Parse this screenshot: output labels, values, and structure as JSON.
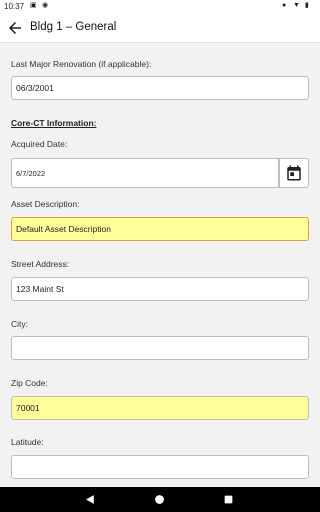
{
  "status_bar": {
    "time": "10:37",
    "icons": [
      "image-icon",
      "at-icon",
      "location-icon",
      "wifi-icon",
      "battery-icon"
    ]
  },
  "app_bar": {
    "title": "Bldg 1 – General",
    "back_icon": "arrow-back-icon"
  },
  "form": {
    "last_major_renovation": {
      "label": "Last Major Renovation (if applicable):",
      "value": "06/3/2001"
    },
    "section_title": "Core-CT Information:",
    "acquired_date": {
      "label": "Acquired Date:",
      "value": "6/7/2022",
      "button_icon": "calendar-icon"
    },
    "asset_description": {
      "label": "Asset Description:",
      "value": "Default Asset Description"
    },
    "street_address": {
      "label": "Street Address:",
      "value": "123 Maint St"
    },
    "city": {
      "label": "City:",
      "value": ""
    },
    "zip_code": {
      "label": "Zip Code:",
      "value": "70001"
    },
    "latitude": {
      "label": "Latitude:",
      "value": ""
    }
  },
  "colors": {
    "required_field_bg": "#ffff99",
    "focus_border": "#e0a03a",
    "page_bg": "#f2f2f2"
  },
  "nav_bar": {
    "buttons": [
      "back-triangle-icon",
      "home-circle-icon",
      "recents-square-icon"
    ]
  }
}
